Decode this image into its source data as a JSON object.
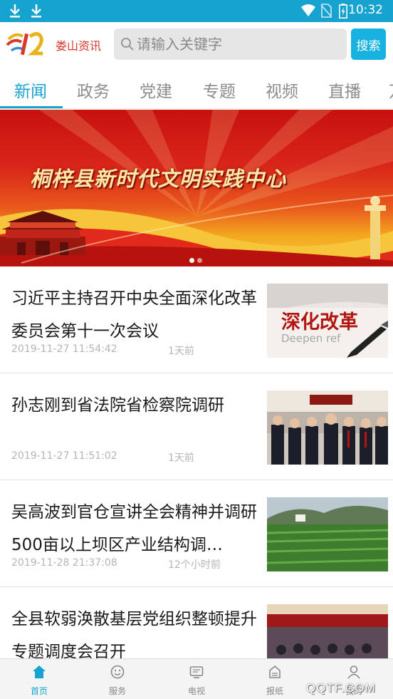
{
  "status_bar": {
    "time": "10:32"
  },
  "header": {
    "app_name": "娄山资讯",
    "search_placeholder": "请输入关键字",
    "search_button": "搜索"
  },
  "tabs": [
    {
      "label": "新闻",
      "active": true
    },
    {
      "label": "政务",
      "active": false
    },
    {
      "label": "党建",
      "active": false
    },
    {
      "label": "专题",
      "active": false
    },
    {
      "label": "视频",
      "active": false
    },
    {
      "label": "直播",
      "active": false
    },
    {
      "label": "万",
      "active": false
    }
  ],
  "banner": {
    "title": "桐梓县新时代文明实践中心",
    "slide_count": 2,
    "active_slide": 1
  },
  "news": [
    {
      "title": "习近平主持召开中央全面深化改革委员会第十一次会议",
      "date": "2019-11-27 11:54:42",
      "ago": "1天前",
      "thumb_text_main": "深化改革",
      "thumb_text_sub": "Deepen ref"
    },
    {
      "title": "孙志刚到省法院省检察院调研",
      "date": "2019-11-27 11:51:02",
      "ago": "1天前"
    },
    {
      "title": "吴高波到官仓宣讲全会精神并调研500亩以上坝区产业结构调…",
      "date": "2019-11-28 21:37:08",
      "ago": "12个小时前"
    },
    {
      "title": "全县软弱涣散基层党组织整顿提升专题调度会召开",
      "date": "",
      "ago": ""
    }
  ],
  "bottom_nav": [
    {
      "label": "首页",
      "icon": "home-icon",
      "active": true
    },
    {
      "label": "服务",
      "icon": "smiley-icon",
      "active": false
    },
    {
      "label": "电视",
      "icon": "tv-icon",
      "active": false
    },
    {
      "label": "报纸",
      "icon": "newspaper-icon",
      "active": false
    },
    {
      "label": "我的",
      "icon": "user-icon",
      "active": false
    }
  ],
  "watermark": "QQTF.COM",
  "colors": {
    "accent": "#17a3cf",
    "status_bar": "#17a3cf",
    "app_name": "#d83a2a"
  }
}
